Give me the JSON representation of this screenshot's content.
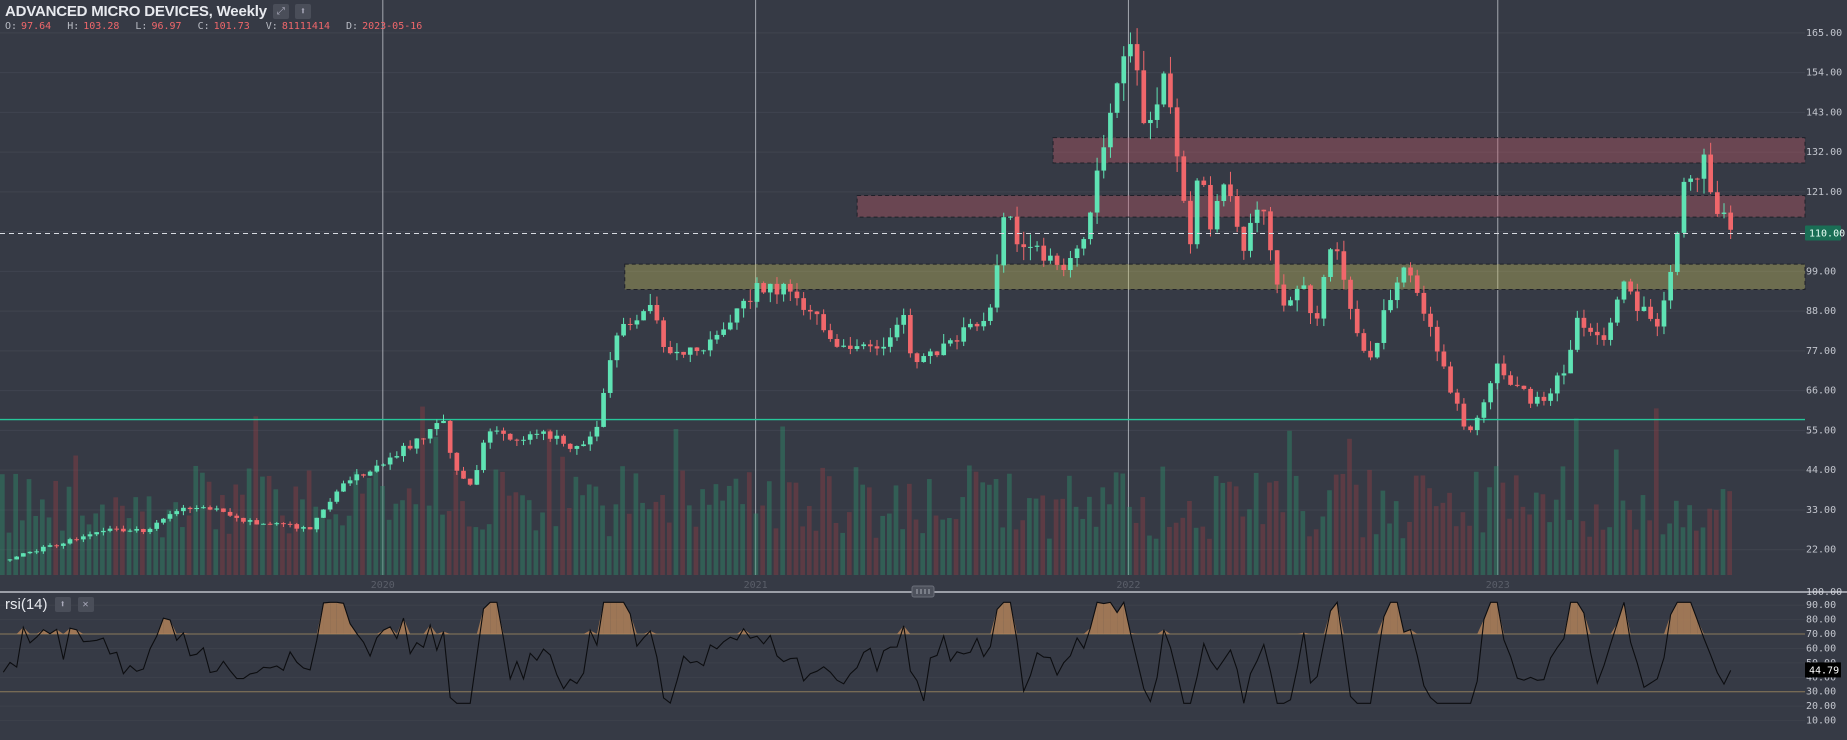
{
  "header": {
    "title": "ADVANCED MICRO DEVICES, Weekly",
    "ohlc": [
      {
        "key": "O:",
        "value": "97.64"
      },
      {
        "key": "H:",
        "value": "103.28"
      },
      {
        "key": "L:",
        "value": "96.97"
      },
      {
        "key": "C:",
        "value": "101.73"
      },
      {
        "key": "V:",
        "value": "81111414"
      },
      {
        "key": "D:",
        "value": "2023-05-16"
      }
    ],
    "icons": [
      "expand-icon",
      "pin-icon"
    ]
  },
  "rsi_panel": {
    "title": "rsi(14)",
    "icons": [
      "arrow-up-icon",
      "close-icon"
    ],
    "current_label": "44.79"
  },
  "chart_data": [
    {
      "type": "candlestick",
      "series_name": "ADVANCED MICRO DEVICES",
      "interval": "Weekly",
      "ylim": [
        15,
        168
      ],
      "y_ticks": [
        "165.00",
        "154.00",
        "143.00",
        "132.00",
        "121.00",
        "110.00",
        "99.00",
        "88.00",
        "77.00",
        "66.00",
        "55.00",
        "44.00",
        "33.00",
        "22.00"
      ],
      "current_price": 109.5,
      "current_label": "110.00",
      "year_labels": [
        "2020",
        "2021",
        "2022",
        "2023"
      ],
      "year_label_fraction": [
        0.215,
        0.43,
        0.645,
        0.858
      ],
      "price_path": [
        [
          0,
          19
        ],
        [
          0.02,
          22
        ],
        [
          0.04,
          25
        ],
        [
          0.06,
          28
        ],
        [
          0.08,
          27
        ],
        [
          0.09,
          31
        ],
        [
          0.1,
          34
        ],
        [
          0.12,
          33
        ],
        [
          0.13,
          30
        ],
        [
          0.15,
          29
        ],
        [
          0.17,
          28
        ],
        [
          0.19,
          40
        ],
        [
          0.21,
          46
        ],
        [
          0.23,
          52
        ],
        [
          0.245,
          58
        ],
        [
          0.25,
          45
        ],
        [
          0.26,
          40
        ],
        [
          0.27,
          56
        ],
        [
          0.28,
          53
        ],
        [
          0.3,
          54
        ],
        [
          0.32,
          50
        ],
        [
          0.33,
          56
        ],
        [
          0.34,
          82
        ],
        [
          0.36,
          90
        ],
        [
          0.37,
          75
        ],
        [
          0.39,
          78
        ],
        [
          0.41,
          90
        ],
        [
          0.42,
          94
        ],
        [
          0.44,
          93
        ],
        [
          0.455,
          85
        ],
        [
          0.47,
          76
        ],
        [
          0.49,
          80
        ],
        [
          0.5,
          88
        ],
        [
          0.505,
          74
        ],
        [
          0.52,
          78
        ],
        [
          0.54,
          85
        ],
        [
          0.55,
          90
        ],
        [
          0.555,
          115
        ],
        [
          0.565,
          108
        ],
        [
          0.58,
          104
        ],
        [
          0.595,
          100
        ],
        [
          0.605,
          118
        ],
        [
          0.615,
          142
        ],
        [
          0.625,
          165
        ],
        [
          0.63,
          152
        ],
        [
          0.635,
          136
        ],
        [
          0.645,
          155
        ],
        [
          0.65,
          140
        ],
        [
          0.66,
          108
        ],
        [
          0.665,
          130
        ],
        [
          0.67,
          110
        ],
        [
          0.68,
          125
        ],
        [
          0.69,
          105
        ],
        [
          0.7,
          120
        ],
        [
          0.71,
          88
        ],
        [
          0.72,
          96
        ],
        [
          0.73,
          86
        ],
        [
          0.74,
          110
        ],
        [
          0.75,
          84
        ],
        [
          0.76,
          74
        ],
        [
          0.77,
          92
        ],
        [
          0.78,
          101
        ],
        [
          0.79,
          86
        ],
        [
          0.8,
          74
        ],
        [
          0.81,
          58
        ],
        [
          0.815,
          56
        ],
        [
          0.82,
          58
        ],
        [
          0.83,
          73
        ],
        [
          0.845,
          65
        ],
        [
          0.855,
          62
        ],
        [
          0.87,
          74
        ],
        [
          0.875,
          86
        ],
        [
          0.89,
          80
        ],
        [
          0.9,
          96
        ],
        [
          0.91,
          88
        ],
        [
          0.92,
          84
        ],
        [
          0.93,
          108
        ],
        [
          0.935,
          128
        ],
        [
          0.94,
          120
        ],
        [
          0.945,
          130
        ],
        [
          0.95,
          120
        ],
        [
          0.96,
          111
        ]
      ],
      "support_line": 58,
      "zones": [
        {
          "name": "resistance-zone-top",
          "low": 129,
          "high": 136,
          "start_fraction": 0.59,
          "color": "#c05a68"
        },
        {
          "name": "resistance-zone-middle",
          "low": 114,
          "high": 120,
          "start_fraction": 0.477,
          "color": "#c05a68"
        },
        {
          "name": "support-zone-yellow",
          "low": 94,
          "high": 101,
          "start_fraction": 0.343,
          "color": "#c8c060"
        }
      ],
      "colors": {
        "up": "#5fe3b4",
        "down": "#f0676b",
        "support": "#26c69a",
        "background": "#363a45"
      }
    },
    {
      "type": "line",
      "series_name": "rsi(14)",
      "ylim": [
        0,
        95
      ],
      "y_ticks": [
        "90.00",
        "80.00",
        "70.00",
        "60.00",
        "50.00",
        "40.00",
        "30.00",
        "20.00",
        "10.00"
      ],
      "overbought": 70,
      "oversold": 30,
      "current_value": 44.79
    }
  ]
}
